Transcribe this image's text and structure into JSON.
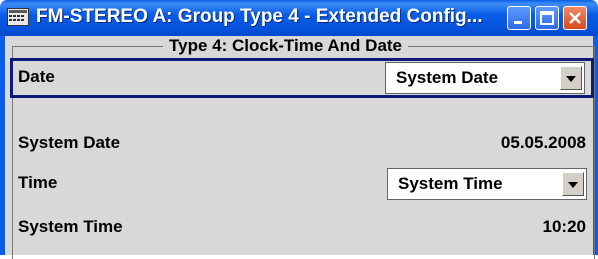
{
  "window": {
    "title": "FM-STEREO A: Group Type 4 - Extended Config...",
    "controls": [
      "minimize",
      "maximize",
      "close"
    ],
    "accent": "#0a5de8"
  },
  "group": {
    "legend": "Type 4: Clock-Time And Date"
  },
  "rows": [
    {
      "label": "Date",
      "control": "dropdown",
      "value": "System Date"
    },
    {
      "label": "System Date",
      "control": "readonly",
      "value": "05.05.2008"
    },
    {
      "label": "Time",
      "control": "dropdown",
      "value": "System Time"
    },
    {
      "label": "System Time",
      "control": "readonly",
      "value": "10:20"
    }
  ]
}
